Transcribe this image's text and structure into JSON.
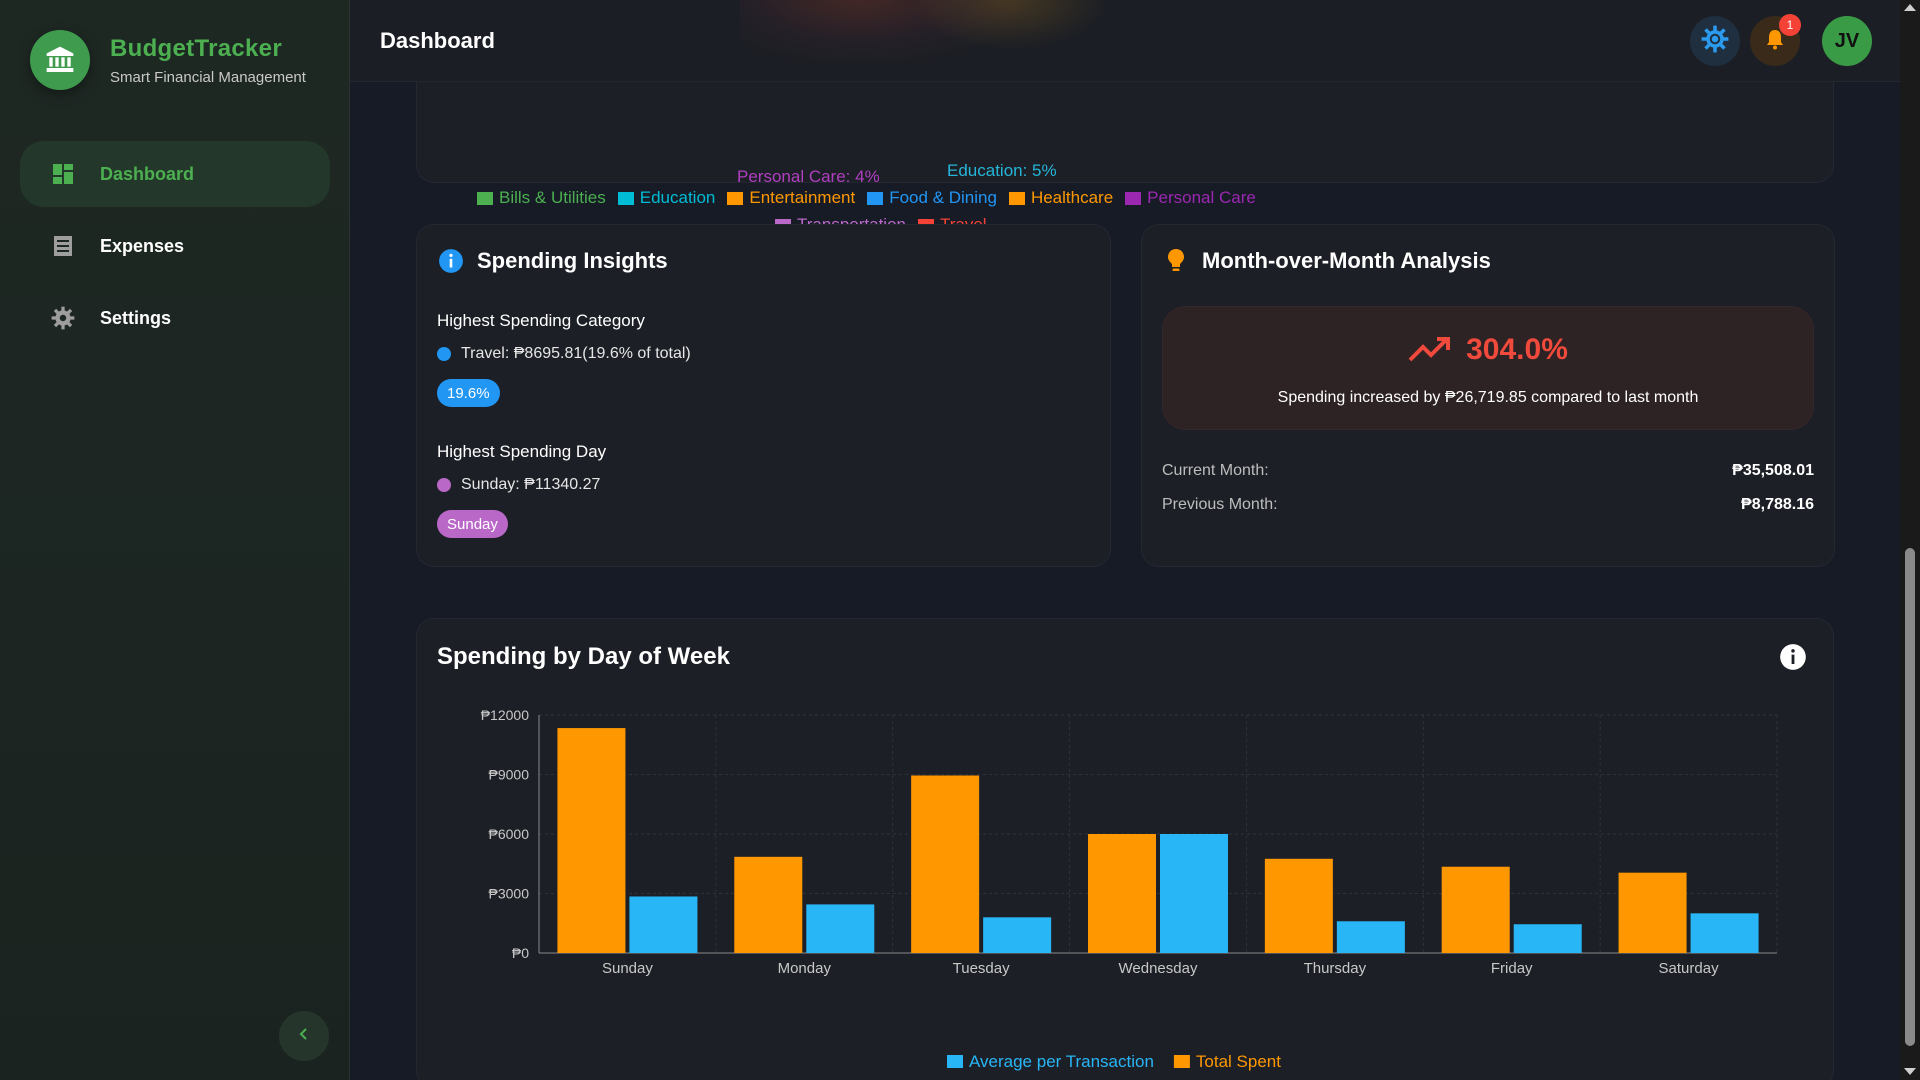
{
  "brand": {
    "title": "BudgetTracker",
    "subtitle": "Smart Financial Management",
    "logo_icon": "bank-icon"
  },
  "sidebar": {
    "items": [
      {
        "label": "Dashboard",
        "icon": "dashboard-icon",
        "active": true
      },
      {
        "label": "Expenses",
        "icon": "receipt-icon",
        "active": false
      },
      {
        "label": "Settings",
        "icon": "gear-icon",
        "active": false
      }
    ],
    "collapse_icon": "chevron-left-icon"
  },
  "header": {
    "title": "Dashboard",
    "notification_count": "1",
    "avatar_initials": "JV"
  },
  "category_chart": {
    "pie_labels": [
      {
        "text": "Personal Care: 4%",
        "color": "#b03ec0"
      },
      {
        "text": "Education: 5%",
        "color": "#26b6d9"
      }
    ],
    "legend": [
      {
        "label": "Bills & Utilities",
        "color": "#4caf50"
      },
      {
        "label": "Education",
        "color": "#00bcd4"
      },
      {
        "label": "Entertainment",
        "color": "#ff9800"
      },
      {
        "label": "Food & Dining",
        "color": "#2196f3"
      },
      {
        "label": "Healthcare",
        "color": "#ff9800"
      },
      {
        "label": "Personal Care",
        "color": "#9c27b0"
      },
      {
        "label": "Transportation",
        "color": "#ba68c8"
      },
      {
        "label": "Travel",
        "color": "#f44336"
      }
    ]
  },
  "insights": {
    "title": "Spending Insights",
    "category_heading": "Highest Spending Category",
    "category_line": "Travel: ₱8695.81(19.6% of total)",
    "category_pill": "19.6%",
    "category_color": "#2196f3",
    "day_heading": "Highest Spending Day",
    "day_line": "Sunday: ₱11340.27",
    "day_pill": "Sunday",
    "day_color": "#ba68c8"
  },
  "mom": {
    "title": "Month-over-Month Analysis",
    "percent": "304.0%",
    "description": "Spending increased by ₱26,719.85 compared to last month",
    "current_label": "Current Month:",
    "current_value": "₱35,508.01",
    "previous_label": "Previous Month:",
    "previous_value": "₱8,788.16",
    "accent": "#ef4a3c"
  },
  "day_chart": {
    "title": "Spending by Day of Week"
  },
  "chart_data": {
    "type": "bar",
    "title": "Spending by Day of Week",
    "categories": [
      "Sunday",
      "Monday",
      "Tuesday",
      "Wednesday",
      "Thursday",
      "Friday",
      "Saturday"
    ],
    "series": [
      {
        "name": "Total Spent",
        "color": "#ff9800",
        "values": [
          11340.27,
          4850,
          8950,
          6000,
          4750,
          4350,
          4050
        ]
      },
      {
        "name": "Average per Transaction",
        "color": "#29b6f6",
        "values": [
          2850,
          2450,
          1800,
          6000,
          1600,
          1450,
          2000
        ]
      }
    ],
    "ylim": [
      0,
      12000
    ],
    "yticks": [
      "₱0",
      "₱3000",
      "₱6000",
      "₱9000",
      "₱12000"
    ],
    "legend_order": [
      "Average per Transaction",
      "Total Spent"
    ],
    "legend_position": "bottom-center",
    "grid": true
  }
}
